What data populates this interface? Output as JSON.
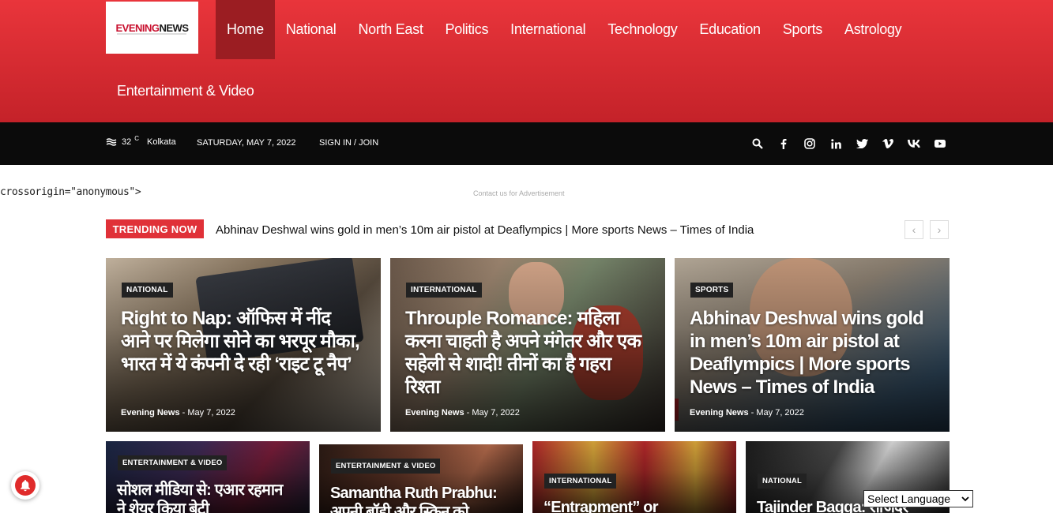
{
  "header": {
    "logo_text_red": "EVENING",
    "logo_text_dark": "NEWS",
    "nav": [
      "Home",
      "National",
      "North East",
      "Politics",
      "International",
      "Technology",
      "Education",
      "Sports",
      "Astrology"
    ],
    "nav_row2": [
      "Entertainment & Video"
    ],
    "active": "Home"
  },
  "topbar": {
    "temperature": "32",
    "unit": "C",
    "city": "Kolkata",
    "date": "SATURDAY, MAY 7, 2022",
    "signin": "SIGN IN / JOIN",
    "social_icons": [
      "search-icon",
      "facebook-icon",
      "instagram-icon",
      "linkedin-icon",
      "twitter-icon",
      "vimeo-icon",
      "vk-icon",
      "youtube-icon"
    ]
  },
  "ad": {
    "crossorigin": "crossorigin=\"anonymous\">",
    "contact": "Contact us for Advertisement"
  },
  "trending": {
    "label": "TRENDING NOW",
    "headline": "Abhinav Deshwal wins gold in men’s 10m air pistol at Deaflympics | More sports News – Times of India",
    "prev": "‹",
    "next": "›"
  },
  "featured": [
    {
      "category": "NATIONAL",
      "title": "Right to Nap: ऑफिस में नींद आने पर मिलेगा सोने का भरपूर मौका, भारत में ये कंपनी दे रही ‘राइट टू नैप’",
      "author": "Evening News",
      "date": "May 7, 2022"
    },
    {
      "category": "INTERNATIONAL",
      "title": "Throuple Romance: महिला करना चाहती है अपने मंगेतर और एक सहेली से शादी! तीनों का है गहरा रिश्ता",
      "author": "Evening News",
      "date": "May 7, 2022"
    },
    {
      "category": "SPORTS",
      "title": "Abhinav Deshwal wins gold in men’s 10m air pistol at Deaflympics | More sports News – Times of India",
      "author": "Evening News",
      "date": "May 7, 2022"
    }
  ],
  "secondary": [
    {
      "category": "ENTERTAINMENT & VIDEO",
      "title": "सोशल मीडिया से: एआर रहमान ने शेयर किया बेटी"
    },
    {
      "category": "ENTERTAINMENT & VIDEO",
      "title": "Samantha Ruth Prabhu: अपनी बॉडी और स्किन को"
    },
    {
      "category": "INTERNATIONAL",
      "title": "“Entrapment” or"
    },
    {
      "category": "NATIONAL",
      "title": "Tajinder Bagga: राजिंदर बग्गा"
    }
  ],
  "bottom": {
    "language": "Select Language"
  }
}
